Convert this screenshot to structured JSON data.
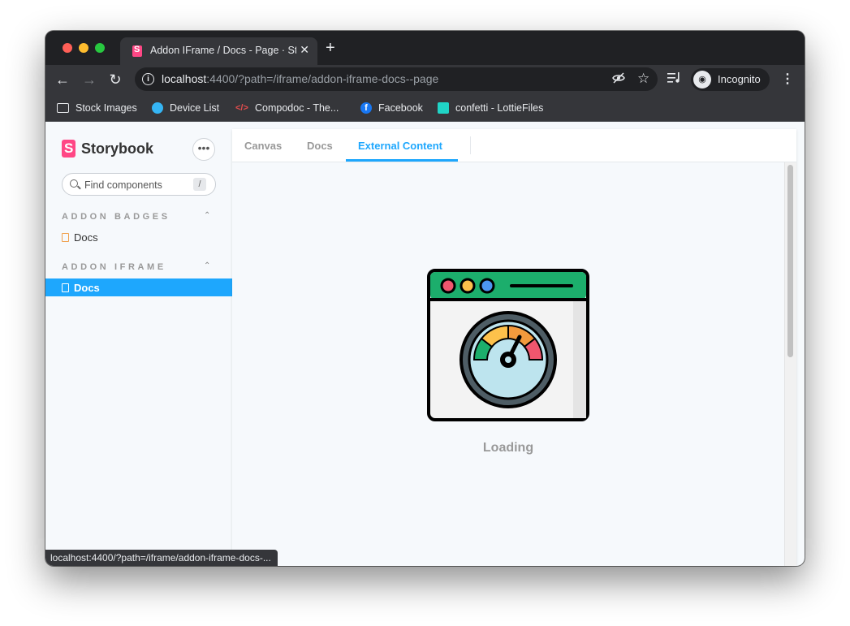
{
  "browser": {
    "tab_title": "Addon IFrame / Docs - Page · Storybook",
    "url_host": "localhost",
    "url_rest": ":4400/?path=/iframe/addon-iframe-docs--page",
    "profile": "Incognito",
    "status_url": "localhost:4400/?path=/iframe/addon-iframe-docs-..."
  },
  "bookmarks": [
    {
      "label": "Stock Images",
      "icon": "folder-icon"
    },
    {
      "label": "Device List",
      "icon": "device-list-icon"
    },
    {
      "label": "Compodoc - The...",
      "icon": "compodoc-icon"
    },
    {
      "label": "Facebook",
      "icon": "facebook-icon"
    },
    {
      "label": "confetti - LottieFiles",
      "icon": "lottiefiles-icon"
    }
  ],
  "sidebar": {
    "brand": "Storybook",
    "search_placeholder": "Find components",
    "search_shortcut": "/",
    "groups": [
      {
        "title": "ADDON BADGES",
        "items": [
          {
            "label": "Docs",
            "active": false
          }
        ]
      },
      {
        "title": "ADDON IFRAME",
        "items": [
          {
            "label": "Docs",
            "active": true
          }
        ]
      }
    ]
  },
  "panel": {
    "tabs": [
      "Canvas",
      "Docs",
      "External Content"
    ],
    "active_tab": "External Content",
    "loading_text": "Loading"
  },
  "colors": {
    "accent": "#1ea7fd",
    "brand": "#ff4785"
  }
}
